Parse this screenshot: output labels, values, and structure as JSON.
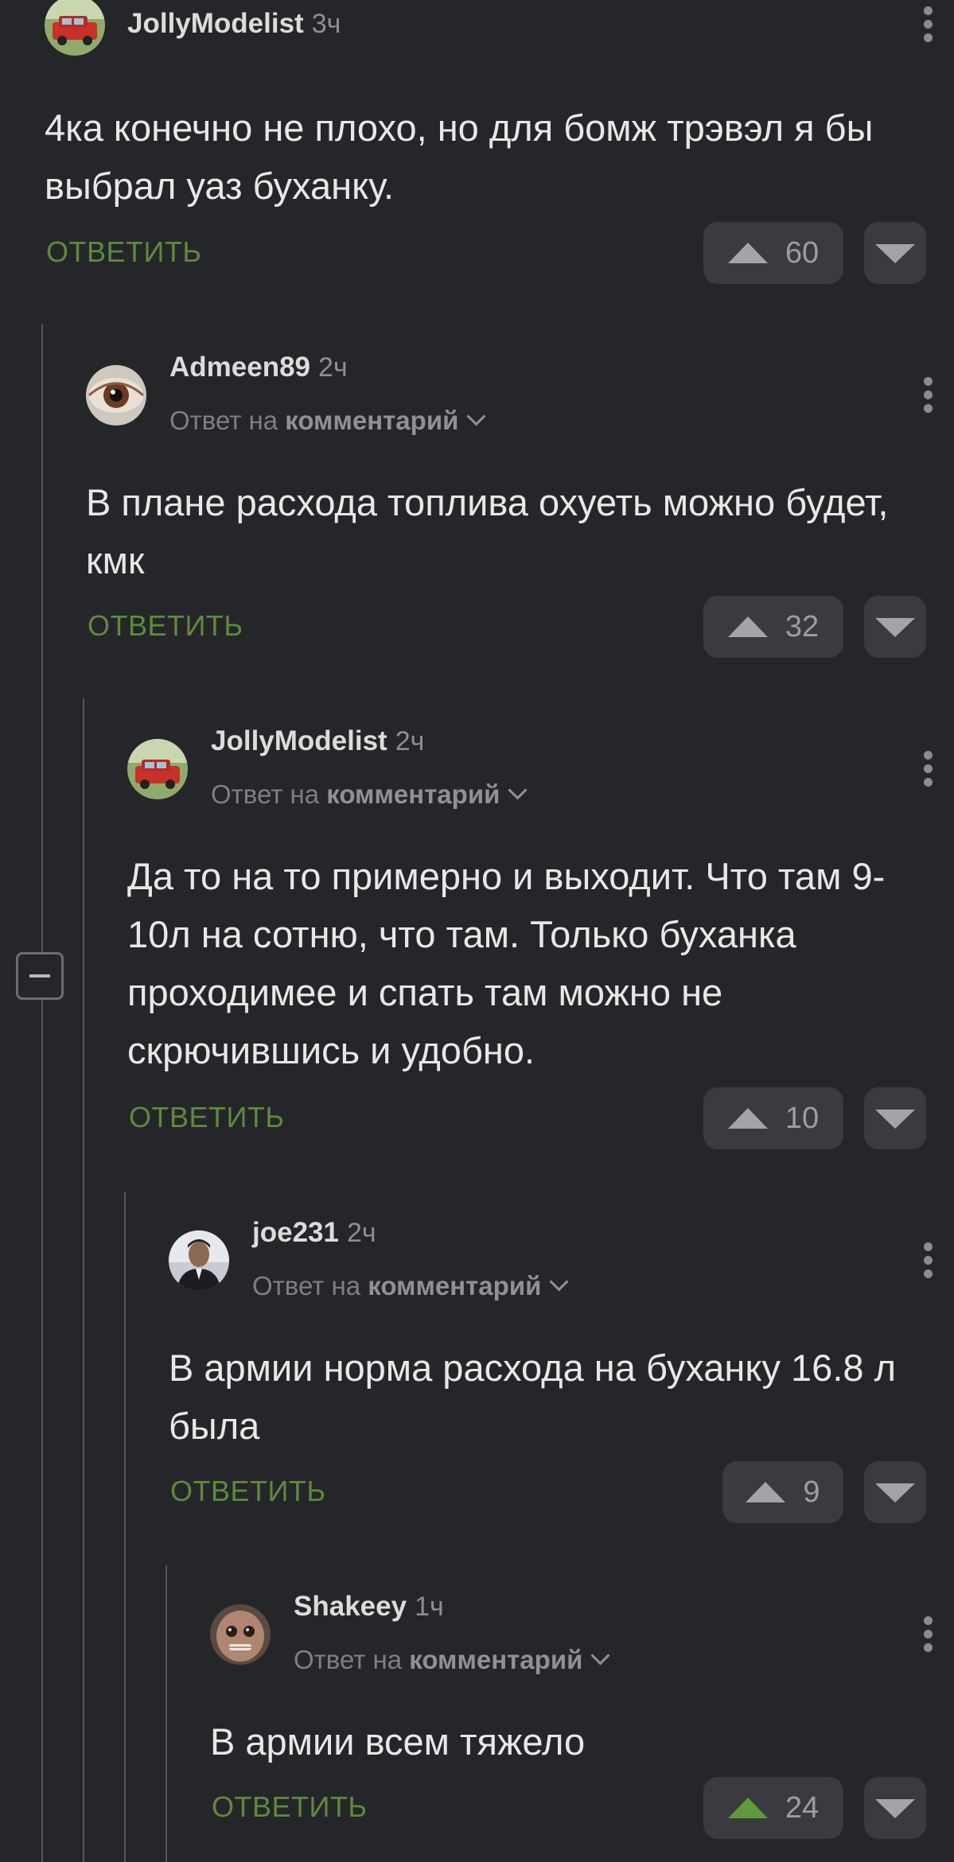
{
  "comments": [
    {
      "author": "JollyModelist",
      "time": "3ч",
      "reply_to": null,
      "text": "4ка конечно не плохо, но для бомж трэвэл я бы выбрал уаз буханку.",
      "reply_label": "ОТВЕТИТЬ",
      "votes": "60",
      "avatar": "car-avatar"
    },
    {
      "author": "Admeen89",
      "time": "2ч",
      "reply_to": {
        "prefix": "Ответ на",
        "target": "комментарий"
      },
      "text": "В плане расхода топлива охуеть можно будет, кмк",
      "reply_label": "ОТВЕТИТЬ",
      "votes": "32",
      "avatar": "eye-avatar"
    },
    {
      "author": "JollyModelist",
      "time": "2ч",
      "reply_to": {
        "prefix": "Ответ на",
        "target": "комментарий"
      },
      "text": "Да то на то примерно и выходит. Что там 9-10л на сотню, что там. Только буханка проходимее и спать там можно не скрючившись и удобно.",
      "reply_label": "ОТВЕТИТЬ",
      "votes": "10",
      "avatar": "car-avatar"
    },
    {
      "author": "joe231",
      "time": "2ч",
      "reply_to": {
        "prefix": "Ответ на",
        "target": "комментарий"
      },
      "text": "В армии норма расхода на буханку 16.8 л была",
      "reply_label": "ОТВЕТИТЬ",
      "votes": "9",
      "avatar": "person-avatar"
    },
    {
      "author": "Shakeey",
      "time": "1ч",
      "reply_to": {
        "prefix": "Ответ на",
        "target": "комментарий"
      },
      "text": "В армии всем тяжело",
      "reply_label": "ОТВЕТИТЬ",
      "votes": "24",
      "upvoted": true,
      "avatar": "creature-avatar"
    }
  ],
  "colors": {
    "background": "#25262a",
    "reply_green": "#5d8a3c",
    "upvote_active": "#5f9a3e"
  }
}
